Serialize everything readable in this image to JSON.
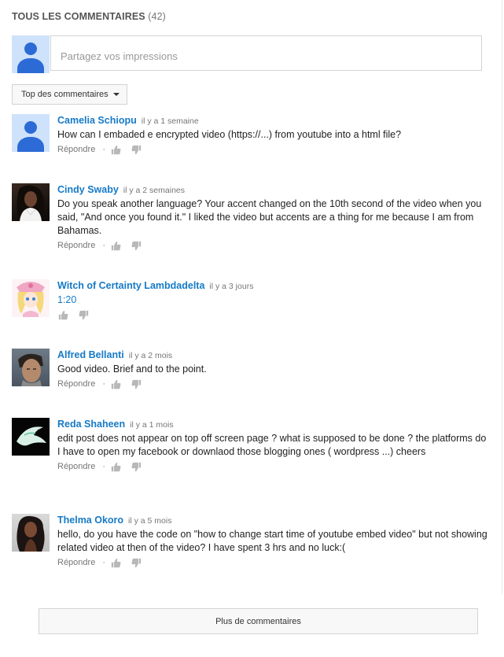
{
  "header": {
    "title": "TOUS LES COMMENTAIRES",
    "count": "(42)"
  },
  "share": {
    "placeholder": "Partagez vos impressions"
  },
  "sort": {
    "label": "Top des commentaires"
  },
  "actions": {
    "reply": "Répondre",
    "separator": "·"
  },
  "comments": [
    {
      "author": "Camelia Schiopu",
      "time": "il y a 1 semaine",
      "text": "How can I embaded e encrypted video (https://...) from youtube into a html file?",
      "has_reply": true
    },
    {
      "author": "Cindy Swaby",
      "time": "il y a 2 semaines",
      "text": "Do you speak another language? Your accent changed on the 10th second of the video when you said, \"And once you found it.\" I liked the video but accents are a thing for me because I am from Bahamas.",
      "has_reply": true
    },
    {
      "author": "Witch of Certainty Lambdadelta",
      "time": "il y a 3 jours",
      "text": "1:20",
      "has_reply": false
    },
    {
      "author": "Alfred Bellanti",
      "time": "il y a 2 mois",
      "text": "Good video. Brief and to the point.",
      "has_reply": true
    },
    {
      "author": "Reda Shaheen",
      "time": "il y a 1 mois",
      "text": "edit post does not appear on top off screen  page ? what is supposed to be done ? the platforms do I have to open my facebook or downlaod those blogging ones ( wordpress ...) cheers",
      "has_reply": true
    },
    {
      "author": "Thelma Okoro",
      "time": "il y a 5 mois",
      "text": "hello, do you have the code on \"how to change start time of youtube embed video\" but not showing related video at then of the video?  I have spent 3 hrs and no luck:(",
      "has_reply": true
    }
  ],
  "more": {
    "label": "Plus de commentaires"
  },
  "colors": {
    "link": "#167ac6",
    "muted": "#767676",
    "avatar_default": "#2c6bd6"
  },
  "icons": {
    "like": "thumbs-up-icon",
    "dislike": "thumbs-down-icon",
    "sort_caret": "caret-down-icon"
  }
}
